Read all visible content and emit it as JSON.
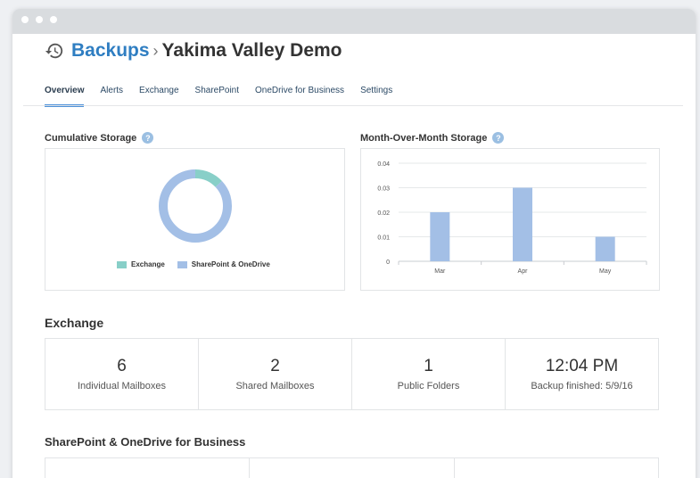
{
  "header": {
    "section": "Backups",
    "separator": "›",
    "current": "Yakima Valley Demo"
  },
  "tabs": [
    {
      "label": "Overview",
      "active": true
    },
    {
      "label": "Alerts"
    },
    {
      "label": "Exchange"
    },
    {
      "label": "SharePoint"
    },
    {
      "label": "OneDrive for Business"
    },
    {
      "label": "Settings"
    }
  ],
  "cumulative": {
    "title": "Cumulative Storage",
    "help": "?",
    "legend": [
      {
        "label": "Exchange",
        "color": "#88cfc8"
      },
      {
        "label": "SharePoint & OneDrive",
        "color": "#a3bfe6"
      }
    ]
  },
  "mom": {
    "title": "Month-Over-Month Storage",
    "help": "?"
  },
  "chart_data": [
    {
      "type": "pie",
      "title": "Cumulative Storage",
      "labels": [
        "Exchange",
        "SharePoint & OneDrive"
      ],
      "values": [
        13,
        87
      ],
      "colors": [
        "#88cfc8",
        "#a3bfe6"
      ],
      "donut": true,
      "legend": "bottom"
    },
    {
      "type": "bar",
      "title": "Month-Over-Month Storage",
      "categories": [
        "Mar",
        "Apr",
        "May"
      ],
      "values": [
        0.02,
        0.03,
        0.01
      ],
      "ylim": [
        0,
        0.04
      ],
      "yticks": [
        "0",
        "0.01",
        "0.02",
        "0.03",
        "0.04"
      ],
      "color": "#a3bfe6",
      "grid": true
    }
  ],
  "exchange": {
    "heading": "Exchange",
    "stats": [
      {
        "value": "6",
        "label": "Individual Mailboxes"
      },
      {
        "value": "2",
        "label": "Shared Mailboxes"
      },
      {
        "value": "1",
        "label": "Public Folders"
      },
      {
        "value": "12:04 PM",
        "label": "Backup finished: 5/9/16"
      }
    ]
  },
  "sharepoint": {
    "heading": "SharePoint & OneDrive for Business"
  }
}
